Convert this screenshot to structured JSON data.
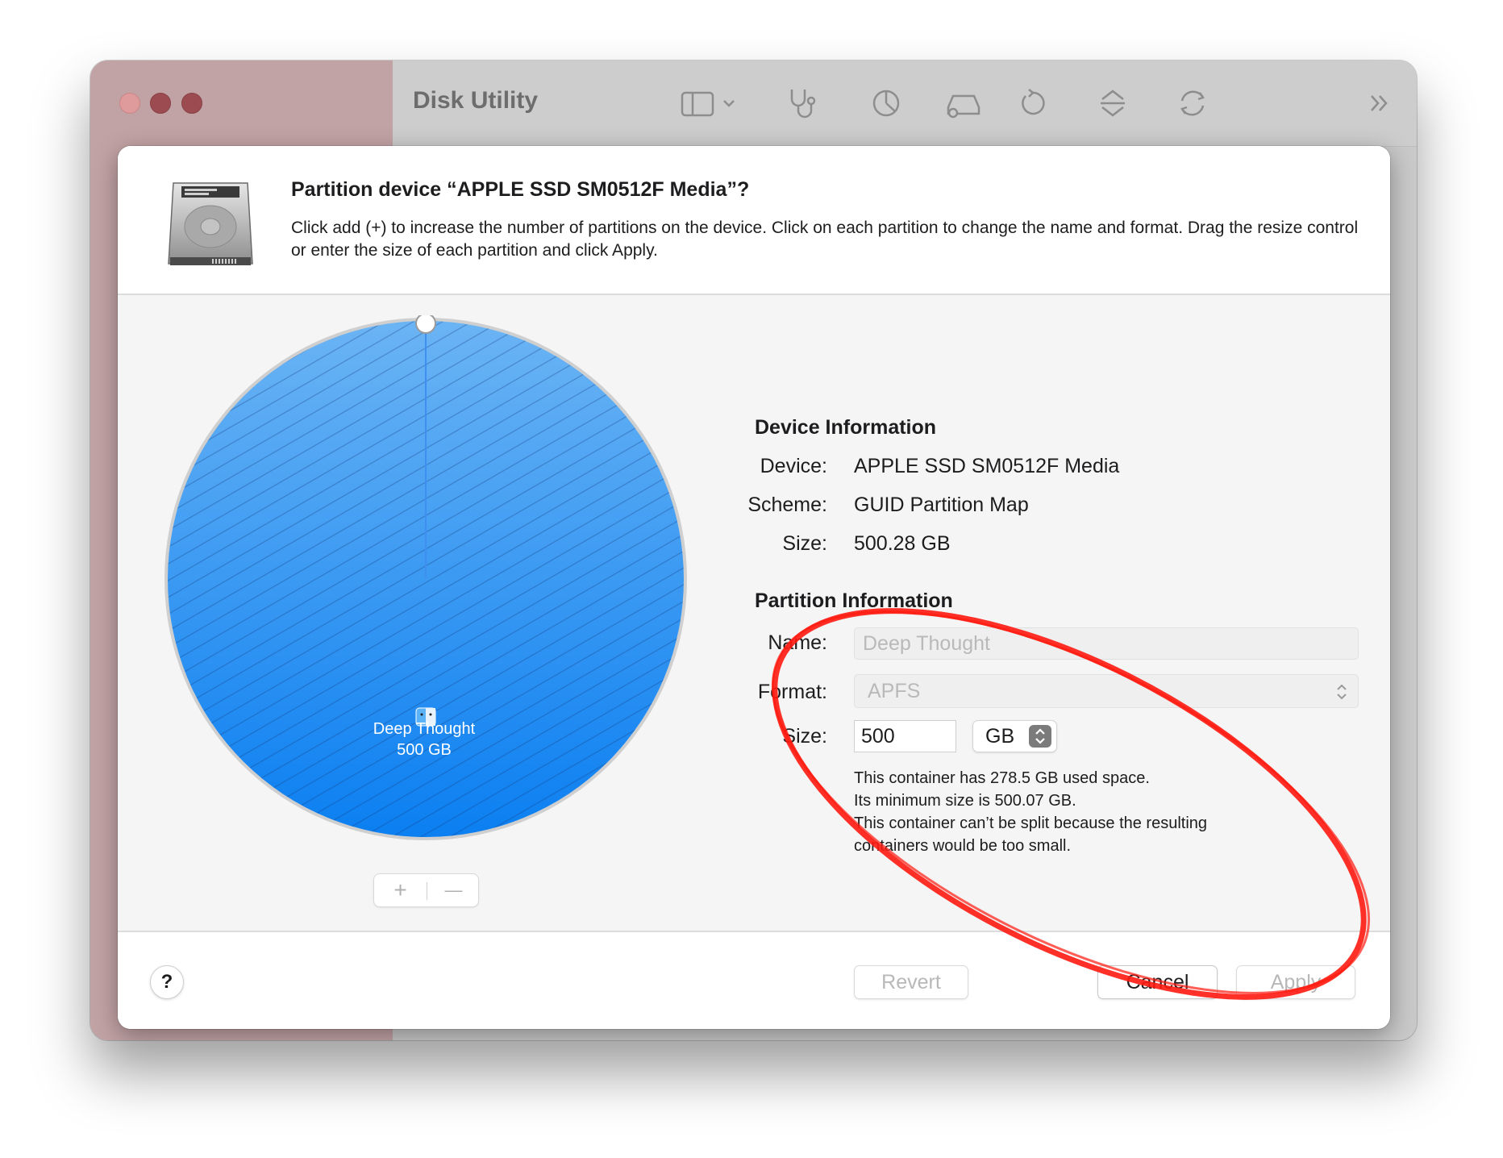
{
  "window": {
    "app_title": "Disk Utility",
    "traffic_lights": [
      "close",
      "minimize",
      "zoom"
    ],
    "toolbar_icons": [
      "sidebar-icon",
      "first-aid-icon",
      "partition-icon",
      "erase-icon",
      "restore-icon",
      "mount-icon",
      "info-icon",
      "more-icon"
    ]
  },
  "sheet": {
    "title": "Partition device “APPLE SSD SM0512F Media”?",
    "description": "Click add (+) to increase the number of partitions on the device. Click on each partition to change the name and format. Drag the resize control or enter the size of each partition and click Apply.",
    "pie": {
      "partition_name": "Deep Thought",
      "partition_size": "500 GB",
      "color": "#2f8ff2",
      "share": 1.0
    },
    "add_label": "+",
    "remove_label": "—",
    "device_info": {
      "heading": "Device Information",
      "device_key": "Device:",
      "device_value": "APPLE SSD SM0512F Media",
      "scheme_key": "Scheme:",
      "scheme_value": "GUID Partition Map",
      "size_key": "Size:",
      "size_value": "500.28 GB"
    },
    "partition_info": {
      "heading": "Partition Information",
      "name_key": "Name:",
      "name_placeholder": "Deep Thought",
      "format_key": "Format:",
      "format_value": "APFS",
      "size_key": "Size:",
      "size_value": "500",
      "size_unit": "GB",
      "notes": [
        "This container has 278.5 GB used space.",
        "Its minimum size is 500.07 GB.",
        "This container can’t be split because the resulting",
        "containers would be too small."
      ]
    },
    "footer": {
      "help_label": "?",
      "revert_label": "Revert",
      "cancel_label": "Cancel",
      "apply_label": "Apply"
    }
  },
  "annotation_color": "#ff1a0f"
}
